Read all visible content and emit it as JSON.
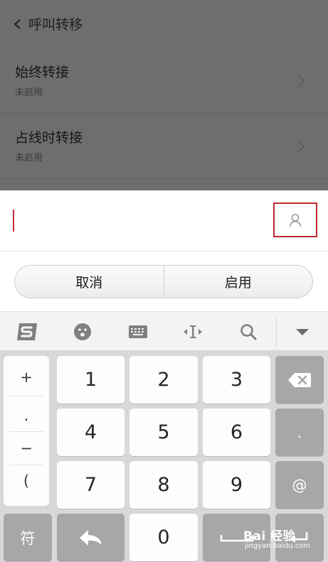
{
  "settings": {
    "title": "呼叫转移",
    "rows": [
      {
        "title": "始终转接",
        "status": "未启用"
      },
      {
        "title": "占线时转接",
        "status": "未启用"
      }
    ]
  },
  "dialog": {
    "input_value": "",
    "cancel_label": "取消",
    "enable_label": "启用"
  },
  "ime_toolbar": {
    "tools": [
      "sogou-logo-icon",
      "emoji-icon",
      "keyboard-icon",
      "cursor-move-icon",
      "search-icon",
      "collapse-icon"
    ]
  },
  "keyboard": {
    "symbols": [
      "+",
      ".",
      "−",
      "("
    ],
    "digits": [
      "1",
      "2",
      "3",
      "4",
      "5",
      "6",
      "7",
      "8",
      "9",
      "0"
    ],
    "dot_label": ".",
    "at_label": "@",
    "symbol_key_label": "符"
  },
  "watermark": {
    "main": "Bai 经验",
    "sub": "jingyan.baidu.com"
  },
  "colors": {
    "highlight_border": "#c1272d",
    "caret": "#c9303a"
  }
}
